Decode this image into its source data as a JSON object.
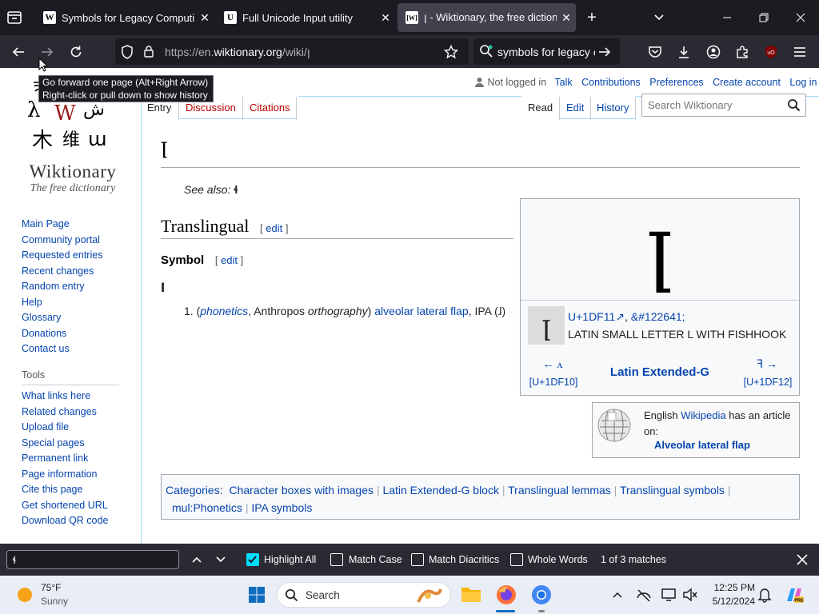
{
  "tabs": [
    {
      "label": "Symbols for Legacy Computing",
      "fav": "W"
    },
    {
      "label": "Full Unicode Input utility",
      "fav": "U"
    },
    {
      "label": "ꞁ - Wiktionary, the free dictionary",
      "fav": "[W]"
    }
  ],
  "urlbar": {
    "url_prefix": "https://en.",
    "url_domain": "wiktionary.org",
    "url_path": "/wiki/ꞁ"
  },
  "searchbar": {
    "value": "symbols for legacy c"
  },
  "tooltip": {
    "line1": "Go forward one page (Alt+Right Arrow)",
    "line2": "Right-click or pull down to show history"
  },
  "wiki": {
    "logo_title": "Wiktionary",
    "logo_subtitle": "The free dictionary",
    "personal": {
      "not_logged_in": "Not logged in",
      "talk": "Talk",
      "contributions": "Contributions",
      "preferences": "Preferences",
      "create_account": "Create account",
      "login": "Log in"
    },
    "tabs_left": {
      "entry": "Entry",
      "discussion": "Discussion",
      "citations": "Citations"
    },
    "tabs_right": {
      "read": "Read",
      "edit": "Edit",
      "history": "History"
    },
    "search_placeholder": "Search Wiktionary",
    "page_title": "ꞁ",
    "see_also_label": "See also:",
    "see_also_value": "ɬ",
    "section1": "Translingual",
    "section1_edit": "edit",
    "section2": "Symbol",
    "section2_edit": "edit",
    "headword": "ꞁ",
    "definition": {
      "num": "1.",
      "phonetics": "phonetics",
      "anthropos": ", Anthropos ",
      "orthography": "orthography",
      "alveolar": "alveolar lateral flap",
      "ipa": ", IPA (ɺ)"
    },
    "charbox": {
      "big_glyph": "ꞁ",
      "small_glyph": "ꞁ",
      "codepoint": "U+1DF11",
      "entity": "&#122641;",
      "name": "LATIN SMALL LETTER L WITH FISHHOOK",
      "prev_glyph": "← ꭺ",
      "prev_code": "[U+1DF10]",
      "block": "Latin Extended-G",
      "next_glyph": "ꟻ →",
      "next_code": "[U+1DF12]"
    },
    "wikipedia_box": {
      "prefix": "English ",
      "link": "Wikipedia",
      "suffix": " has an article on:",
      "article": "Alveolar lateral flap"
    },
    "categories_label": "Categories",
    "categories": [
      "Character boxes with images",
      "Latin Extended-G block",
      "Translingual lemmas",
      "Translingual symbols",
      "mul:Phonetics",
      "IPA symbols"
    ],
    "sidenav_main": [
      "Main Page",
      "Community portal",
      "Requested entries",
      "Recent changes",
      "Random entry",
      "Help",
      "Glossary",
      "Donations",
      "Contact us"
    ],
    "tools_heading": "Tools",
    "sidenav_tools": [
      "What links here",
      "Related changes",
      "Upload file",
      "Special pages",
      "Permanent link",
      "Page information",
      "Cite this page",
      "Get shortened URL",
      "Download QR code"
    ]
  },
  "findbar": {
    "value": "ɬ",
    "highlight_all": "Highlight All",
    "match_case": "Match Case",
    "match_diacritics": "Match Diacritics",
    "whole_words": "Whole Words",
    "status": "1 of 3 matches"
  },
  "taskbar": {
    "temp": "75°F",
    "weather": "Sunny",
    "search": "Search",
    "time": "12:25 PM",
    "date": "5/12/2024"
  }
}
